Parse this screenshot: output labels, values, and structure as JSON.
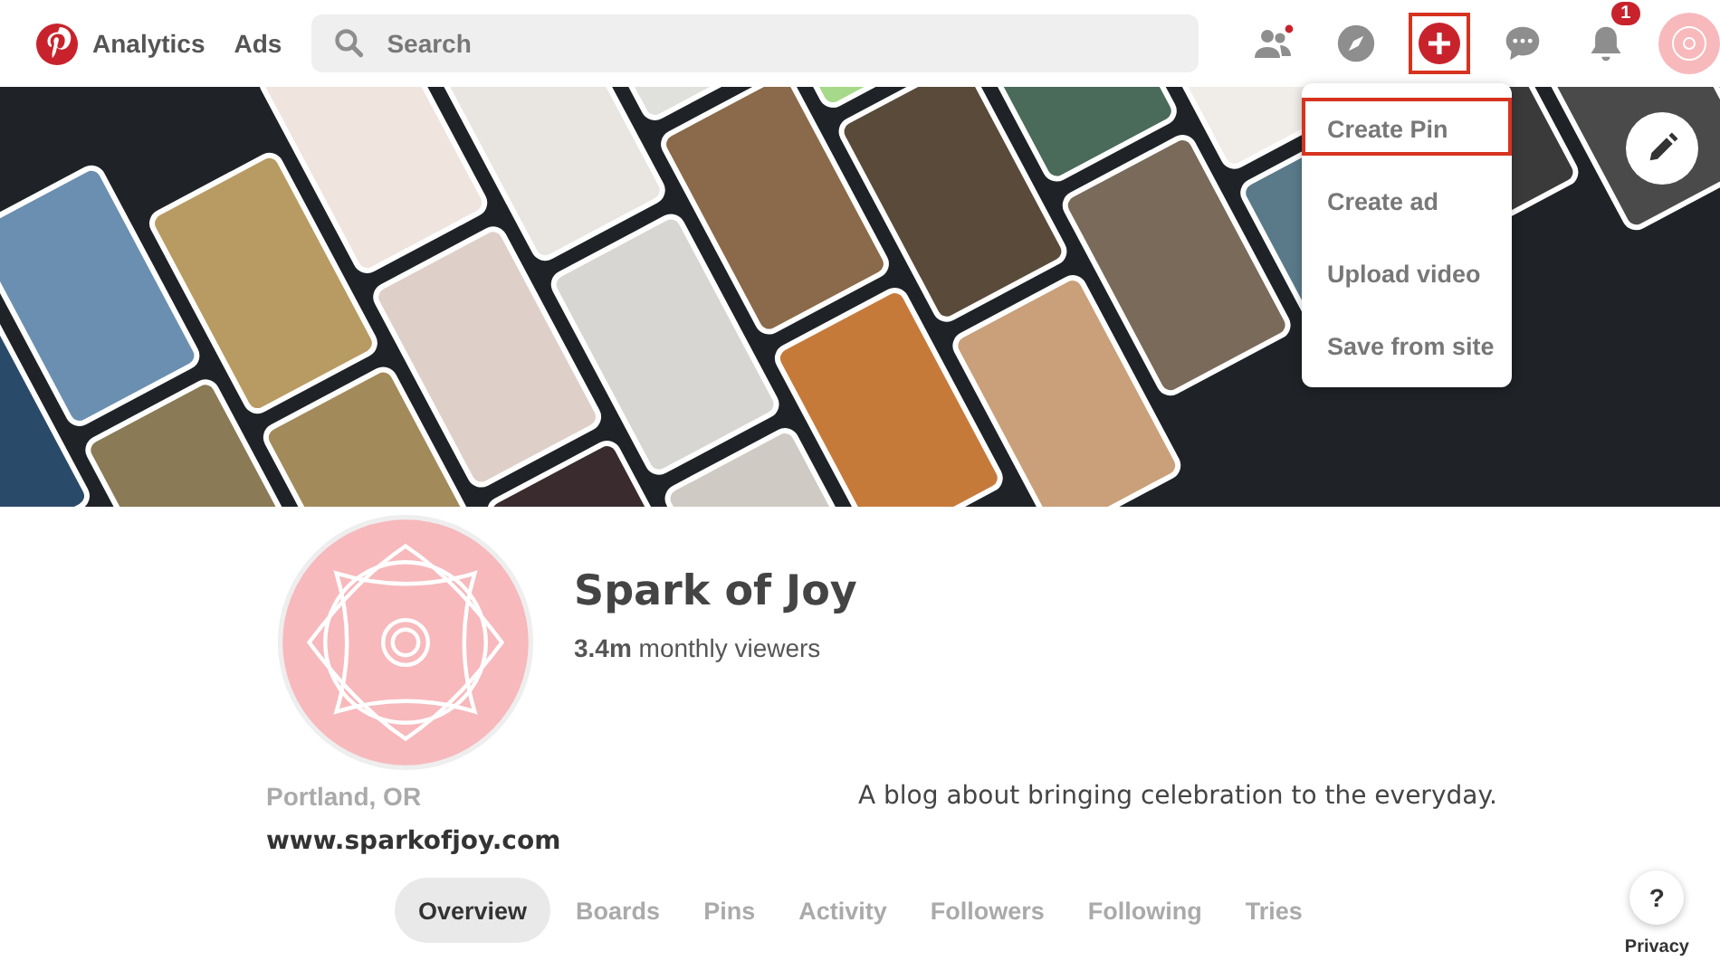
{
  "header": {
    "nav_links": [
      "Analytics",
      "Ads"
    ],
    "search": {
      "placeholder": "Search"
    },
    "create_button": {
      "highlighted": true
    },
    "notifications": {
      "badge": "1"
    }
  },
  "create_menu": [
    {
      "label": "Create Pin",
      "highlighted": true
    },
    {
      "label": "Create ad",
      "highlighted": false
    },
    {
      "label": "Upload video",
      "highlighted": false
    },
    {
      "label": "Save from site",
      "highlighted": false
    }
  ],
  "profile": {
    "name": "Spark of Joy",
    "viewers": "**3.4m** monthly viewers",
    "location": "Portland, OR",
    "website": "www.sparkofjoy.com",
    "bio": "A blog about bringing celebration to the everyday."
  },
  "tabs": [
    {
      "label": "Overview",
      "selected": true
    },
    {
      "label": "Boards",
      "selected": false
    },
    {
      "label": "Pins",
      "selected": false
    },
    {
      "label": "Activity",
      "selected": false
    },
    {
      "label": "Followers",
      "selected": false
    },
    {
      "label": "Following",
      "selected": false
    },
    {
      "label": "Tries",
      "selected": false
    }
  ],
  "help": {
    "icon": "?",
    "label": "Privacy"
  }
}
